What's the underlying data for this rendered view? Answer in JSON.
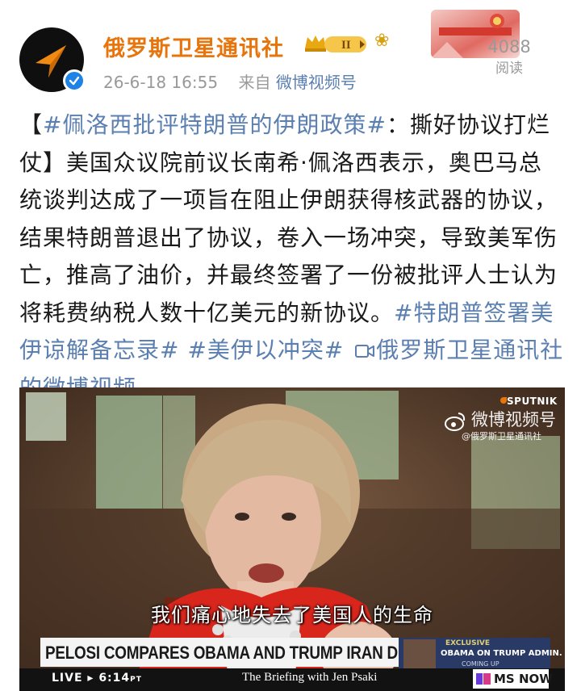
{
  "header": {
    "account_name": "俄罗斯卫星通讯社",
    "vip_level": "II",
    "timestamp": "26-6-18 16:55",
    "source_prefix": "来自",
    "source": "微博视频号",
    "read_count": "4088",
    "read_label": "阅读"
  },
  "post": {
    "open_bracket": "【",
    "title_tag": "#佩洛西批评特朗普的伊朗政策#",
    "title_rest": "：撕好协议打烂仗】",
    "body": "美国众议院前议长南希·佩洛西表示，奥巴马总统谈判达成了一项旨在阻止伊朗获得核武器的协议，结果特朗普退出了协议，卷入一场冲突，导致美军伤亡，推高了油价，并最终签署了一份被批评人士认为将耗费纳税人数十亿美元的新协议。",
    "tag_1": "#特朗普签署美伊谅解备忘录#",
    "tag_2": "#美伊以冲突#",
    "video_link": "俄罗斯卫星通讯社的微博视频"
  },
  "video": {
    "watermark_channel": "微博视频号",
    "watermark_handle": "@俄罗斯卫星通讯社",
    "sputnik": "SPUTNIK",
    "subtitle": "我们痛心地失去了美国人的生命",
    "headline": "PELOSI COMPARES OBAMA AND TRUMP IRAN DEALS",
    "exclusive": "EXCLUSIVE",
    "side_title": "OBAMA ON TRUMP ADMIN.",
    "coming_up": "COMING UP",
    "live": "LIVE",
    "live_time": "6:14",
    "live_ampm": "PT",
    "show_name": "The Briefing with Jen Psaki",
    "network": "MS NOW"
  },
  "colors": {
    "account_orange": "#e8740c",
    "link_blue": "#5a7fb0",
    "verified_blue": "#1e82e6",
    "meta_gray": "#999999"
  }
}
